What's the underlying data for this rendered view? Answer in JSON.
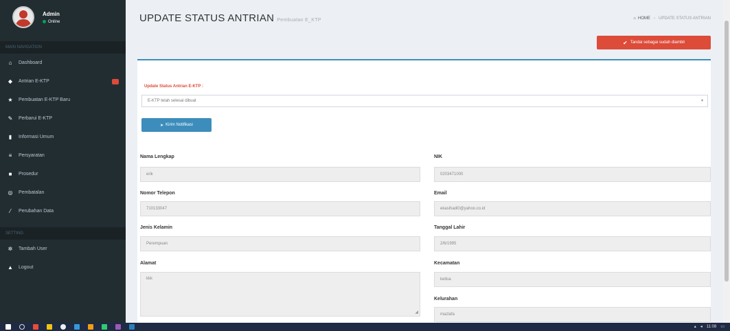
{
  "user": {
    "name": "Admin",
    "status": "Online"
  },
  "sidebar": {
    "header1": "MAIN NAVIGATION",
    "items": [
      {
        "icon": "home-icon",
        "glyph": "⌂",
        "label": "Dashboard"
      },
      {
        "icon": "tag-icon",
        "glyph": "◆",
        "label": "Antrian E-KTP",
        "badge": true
      },
      {
        "icon": "star-icon",
        "glyph": "★",
        "label": "Pembuatan E-KTP Baru"
      },
      {
        "icon": "pencil-icon",
        "glyph": "✎",
        "label": "Perbarui E-KTP"
      },
      {
        "icon": "book-icon",
        "glyph": "▮",
        "label": "Informasi Umum"
      },
      {
        "icon": "list-icon",
        "glyph": "≡",
        "label": "Persyaratan"
      },
      {
        "icon": "flag-icon",
        "glyph": "■",
        "label": "Prosedur"
      },
      {
        "icon": "globe-icon",
        "glyph": "◎",
        "label": "Pembatalan"
      },
      {
        "icon": "edit-icon",
        "glyph": "⁄",
        "label": "Perubahan Data"
      }
    ],
    "header2": "SETTING",
    "items2": [
      {
        "icon": "gear-icon",
        "glyph": "✲",
        "label": "Tambah User"
      },
      {
        "icon": "lock-icon",
        "glyph": "▲",
        "label": "Logout"
      }
    ]
  },
  "header": {
    "title": "UPDATE STATUS ANTRIAN",
    "subtitle": "Pembuatan E_KTP",
    "breadcrumb_home": "HOME",
    "breadcrumb_current": "UPDATE STATUS ANTRIAN"
  },
  "actions": {
    "done_label": "Tandai sebagai sudah diambil",
    "send_label": "Kirim Notifikasi"
  },
  "form": {
    "status_label": "Update Status Antrian E-KTP :",
    "status_value": "E-KTP telah selesai dibuat",
    "nama_label": "Nama Lengkap",
    "nama_value": "erik",
    "nik_label": "NIK",
    "nik_value": "0203471000",
    "telepon_label": "Nomor Telepon",
    "telepon_value": "710133047",
    "email_label": "Email",
    "email_value": "ekasihadi0@yahoo.co.id",
    "jk_label": "Jenis Kelamin",
    "jk_value": "Perempuan",
    "lahir_label": "Tanggal Lahir",
    "lahir_value": "2/6/1995",
    "alamat_label": "Alamat",
    "alamat_value": "kkk",
    "kecamatan_label": "Kecamatan",
    "kecamatan_value": "kelloa",
    "kelurahan_label": "Kelurahan",
    "kelurahan_value": "mazlafa"
  },
  "taskbar": {
    "time": "11:08"
  },
  "colors": {
    "sidebar": "#222d32",
    "primary": "#3c8dbc",
    "danger": "#dd4b39"
  }
}
